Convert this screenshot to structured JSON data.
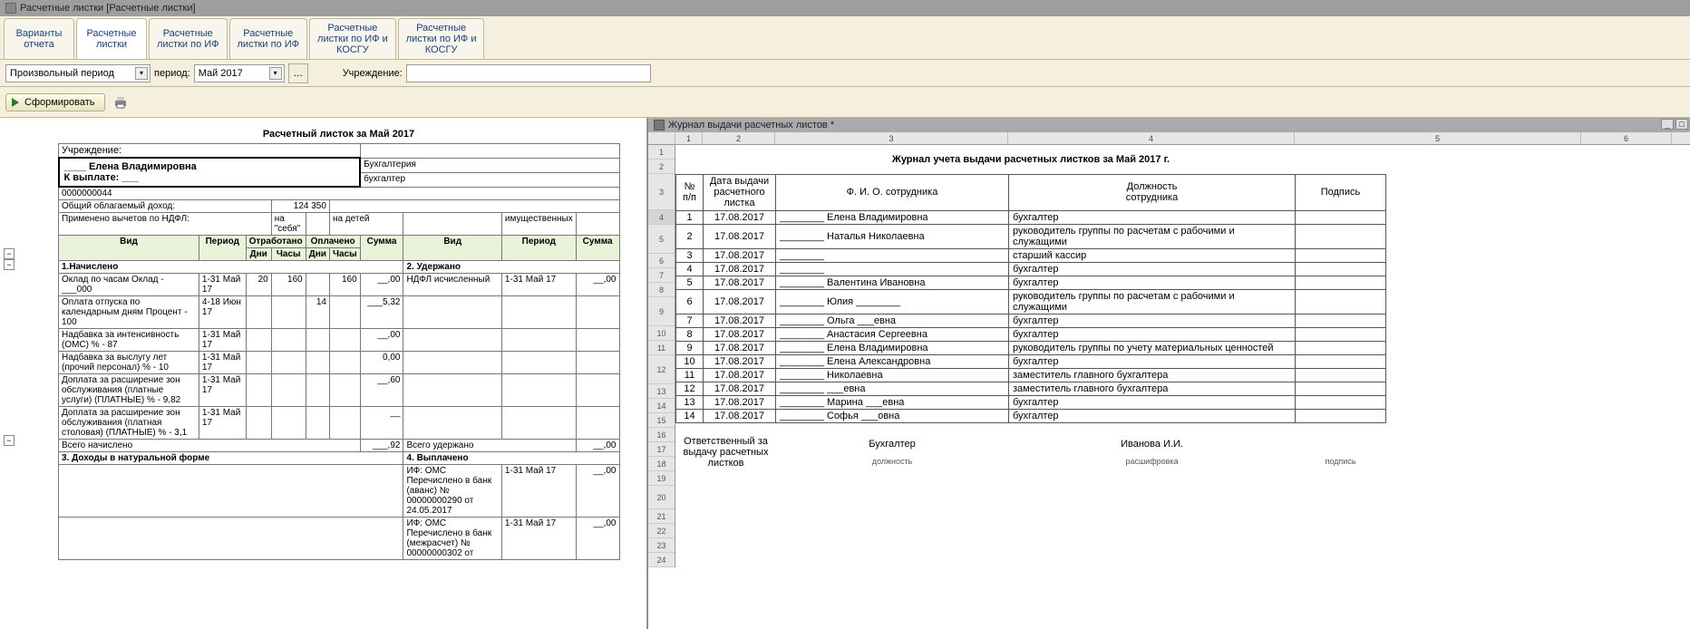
{
  "window_title": "Расчетные листки [Расчетные листки]",
  "tabs": {
    "t1": "Варианты\nотчета",
    "t2": "Расчетные\nлистки",
    "t3": "Расчетные\nлистки по ИФ",
    "t4": "Расчетные\nлистки по ИФ",
    "t5": "Расчетные\nлистки по ИФ и\nКОСГУ",
    "t6": "Расчетные\nлистки по ИФ и\nКОСГУ"
  },
  "params": {
    "period_type": "Произвольный период",
    "period_label": "период:",
    "period_value": "Май 2017",
    "inst_label": "Учреждение:",
    "inst_value": ""
  },
  "toolbar": {
    "form_btn": "Сформировать"
  },
  "slip": {
    "title": "Расчетный листок за Май 2017",
    "inst_label": "Учреждение:",
    "inst_value": "",
    "name_line": "____ Елена Владимировна",
    "payout_label": "К выплате:",
    "payout_value": "___",
    "dept": "Бухгалтерия",
    "pos": "бухгалтер",
    "tabno": "0000000044",
    "income_label": "Общий облагаемый доход:",
    "income_value": "124 350",
    "ndfl_deduct_label": "Применено вычетов по НДФЛ:",
    "ndfl_self": "на \"себя\"",
    "ndfl_kids": "на детей",
    "ndfl_prop": "имущественных",
    "cols": {
      "vid": "Вид",
      "period": "Период",
      "otr": "Отработано",
      "opl": "Оплачено",
      "sum": "Сумма",
      "days": "Дни",
      "hours": "Часы"
    },
    "sec1": "1.Начислено",
    "sec2": "2. Удержано",
    "sec3": "3. Доходы в натуральной форме",
    "sec4": "4. Выплачено",
    "r1_name": "Оклад по часам Оклад - ___000",
    "r1_per": "1-31 Май 17",
    "r1_d": "20",
    "r1_h": "160",
    "r1_oh": "160",
    "r1_sum": "__,00",
    "r1b_name": "НДФЛ исчисленный",
    "r1b_per": "1-31 Май 17",
    "r1b_sum": "__,00",
    "r2_name": "Оплата отпуска по календарным дням Процент - 100",
    "r2_per": "4-18 Июн 17",
    "r2_od": "14",
    "r2_sum": "___5,32",
    "r3_name": "Надбавка за интенсивность (ОМС) % - 87",
    "r3_per": "1-31 Май 17",
    "r3_sum": "__,00",
    "r4_name": "Надбавка за выслугу лет (прочий персонал) % - 10",
    "r4_per": "1-31 Май 17",
    "r4_sum": "0,00",
    "r5_name": "Доплата за расширение зон обслуживания (платные услуги) (ПЛАТНЫЕ) % - 9,82",
    "r5_per": "1-31 Май 17",
    "r5_sum": "__,60",
    "r6_name": "Доплата за расширение зон обслуживания (платная столовая) (ПЛАТНЫЕ) % - 3,1",
    "r6_per": "1-31 Май 17",
    "r6_sum": "__",
    "tot_n_label": "Всего начислено",
    "tot_n": "___,92",
    "tot_u_label": "Всего удержано",
    "tot_u": "__,00",
    "pay1": "ИФ: ОМС Перечислено в банк (аванс) № 00000000290 от 24.05.2017",
    "pay1_per": "1-31 Май 17",
    "pay1_sum": "__,00",
    "pay2": "ИФ: ОМС Перечислено в банк (межрасчет) № 00000000302 от",
    "pay2_per": "1-31 Май 17",
    "pay2_sum": "__,00"
  },
  "right_title": "Журнал выдачи расчетных листов *",
  "journal": {
    "title": "Журнал учета выдачи расчетных листков за Май 2017 г.",
    "h_num": "№ п/п",
    "h_date": "Дата выдачи расчетного листка",
    "h_fio": "Ф. И. О. сотрудника",
    "h_pos": "Должность\nсотрудника",
    "h_sign": "Подпись",
    "rows": [
      {
        "n": "1",
        "d": "17.08.2017",
        "f": "________ Елена Владимировна",
        "p": "бухгалтер"
      },
      {
        "n": "2",
        "d": "17.08.2017",
        "f": "________ Наталья Николаевна",
        "p": "руководитель группы по расчетам с рабочими и служащими"
      },
      {
        "n": "3",
        "d": "17.08.2017",
        "f": "________",
        "p": "старший кассир"
      },
      {
        "n": "4",
        "d": "17.08.2017",
        "f": "________",
        "p": "бухгалтер"
      },
      {
        "n": "5",
        "d": "17.08.2017",
        "f": "________ Валентина Ивановна",
        "p": "бухгалтер"
      },
      {
        "n": "6",
        "d": "17.08.2017",
        "f": "________ Юлия ________",
        "p": "руководитель группы по расчетам с рабочими и служащими"
      },
      {
        "n": "7",
        "d": "17.08.2017",
        "f": "________ Ольга ___евна",
        "p": "бухгалтер"
      },
      {
        "n": "8",
        "d": "17.08.2017",
        "f": "________ Анастасия Сергеевна",
        "p": "бухгалтер"
      },
      {
        "n": "9",
        "d": "17.08.2017",
        "f": "________ Елена Владимировна",
        "p": "руководитель группы по учету материальных ценностей"
      },
      {
        "n": "10",
        "d": "17.08.2017",
        "f": "________ Елена Александровна",
        "p": "бухгалтер"
      },
      {
        "n": "11",
        "d": "17.08.2017",
        "f": "________ Николаевна",
        "p": "заместитель главного бухгалтера"
      },
      {
        "n": "12",
        "d": "17.08.2017",
        "f": "________ ___евна",
        "p": "заместитель главного бухгалтера"
      },
      {
        "n": "13",
        "d": "17.08.2017",
        "f": "________ Марина ___евна",
        "p": "бухгалтер"
      },
      {
        "n": "14",
        "d": "17.08.2017",
        "f": "________ Софья ___овна",
        "p": "бухгалтер"
      }
    ],
    "footer_label": "Ответственный за выдачу расчетных листков",
    "footer_pos": "Бухгалтер",
    "footer_pos_sub": "должность",
    "footer_name": "Иванова И.И.",
    "footer_name_sub": "расшифровка",
    "footer_sign_sub": "подпись"
  }
}
